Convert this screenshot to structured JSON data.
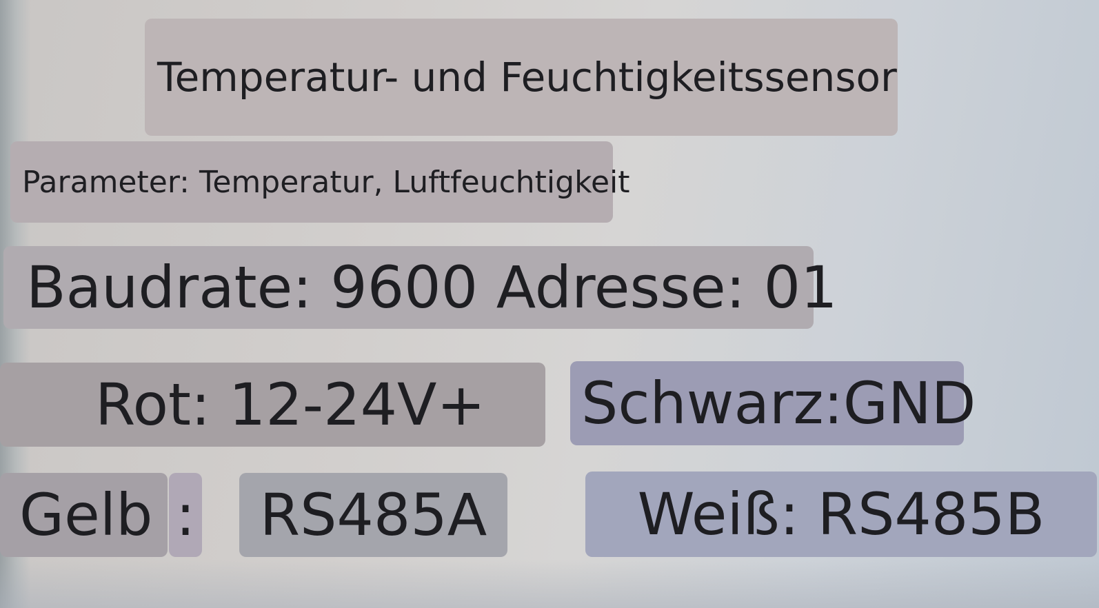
{
  "label": {
    "title": "Temperatur- und Feuchtigkeitssensor",
    "parameters": "Parameter: Temperatur, Luftfeuchtigkeit",
    "baud_address": "Baudrate: 9600 Adresse: 01",
    "red_wire": "Rot: 12-24V+",
    "black_wire": "Schwarz:GND",
    "yellow_label": "Gelb",
    "yellow_separator": ":",
    "yellow_value": "RS485A",
    "white_wire": "Weiß: RS485B"
  },
  "colors": {
    "text": "#1e1e22",
    "title_tag": "#bdb5b6",
    "schwarz_tag": "#9c9cb4",
    "weiss_tag": "#a2a6bc"
  }
}
